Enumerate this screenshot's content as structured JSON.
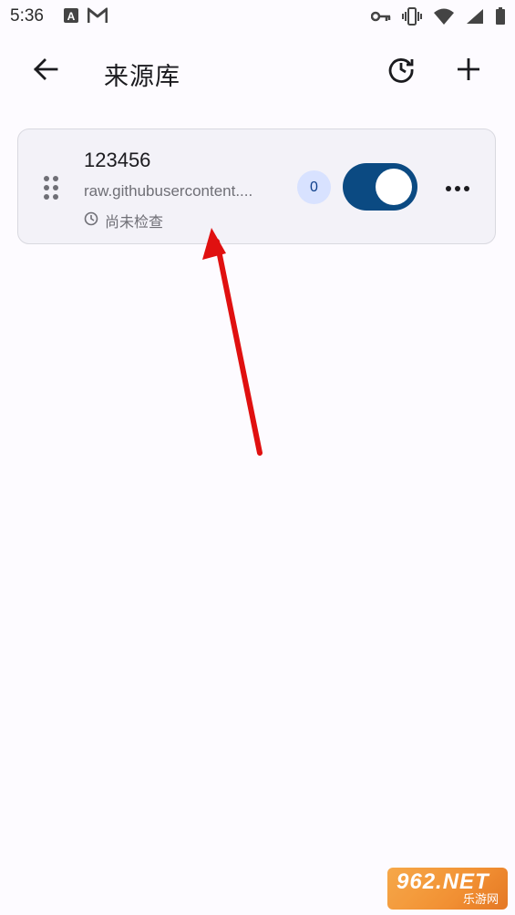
{
  "status_bar": {
    "time": "5:36",
    "left_icons": [
      "text-a-icon",
      "gmail-icon"
    ],
    "right_icons": [
      "key-icon",
      "vibrate-icon",
      "wifi-icon",
      "signal-icon",
      "battery-icon"
    ]
  },
  "app_bar": {
    "title": "来源库",
    "back_icon": "arrow-left-icon",
    "history_icon": "history-icon",
    "add_icon": "plus-icon"
  },
  "sources": [
    {
      "name": "123456",
      "url": "raw.githubusercontent....",
      "status": "尚未检查",
      "count": "0",
      "enabled": true
    }
  ],
  "watermark": {
    "top": "962.NET",
    "bottom": "乐游网"
  },
  "colors": {
    "background": "#fdfbff",
    "card_background": "#f3f2f8",
    "toggle_on": "#0b4a82",
    "badge_background": "#d8e2ff",
    "badge_text": "#0e3f8a",
    "annotation_arrow": "#e01010"
  }
}
